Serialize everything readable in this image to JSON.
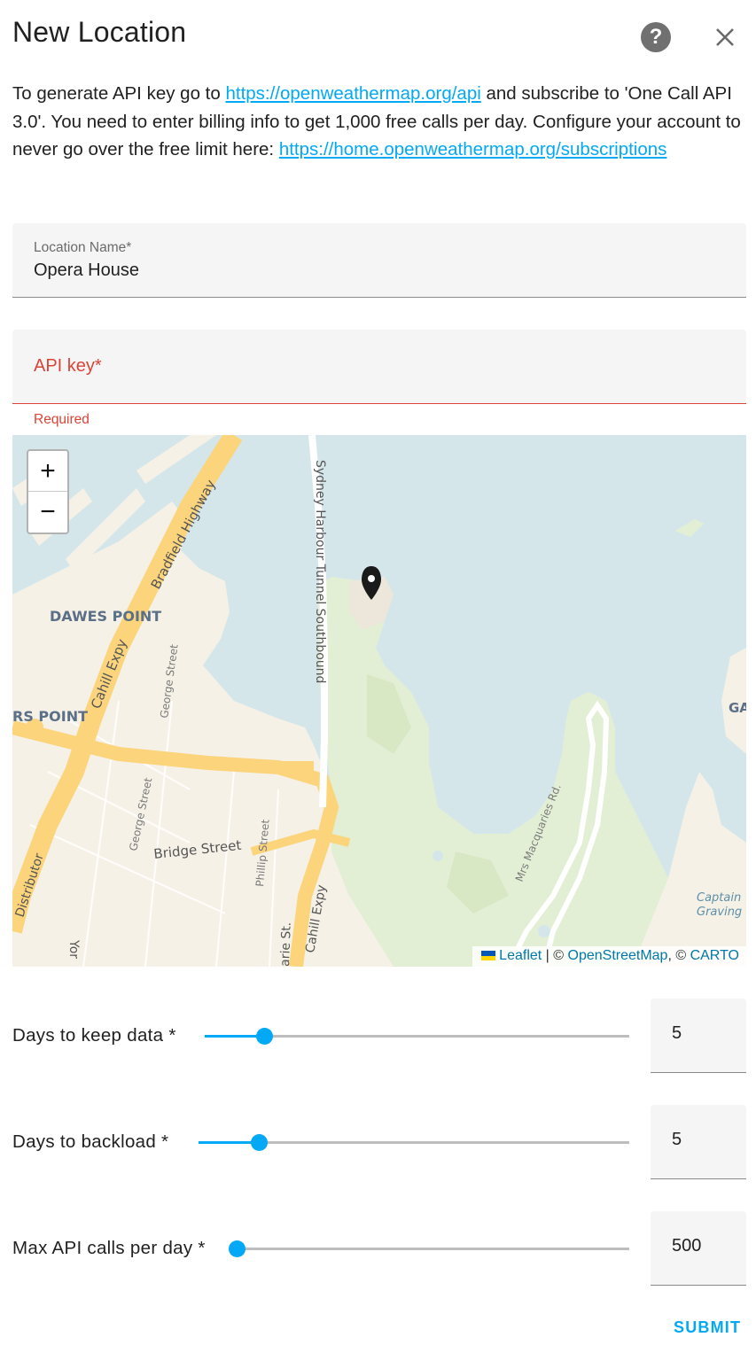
{
  "dialog": {
    "title": "New Location",
    "help_icon": "help-circle-icon",
    "close_icon": "close-icon"
  },
  "intro": {
    "text_1": "To generate API key go to ",
    "link_1": "https://openweathermap.org/api",
    "text_2": " and subscribe to 'One Call API 3.0'. You need to enter billing info to get 1,000 free calls per day. Configure your account to never go over the free limit here: ",
    "link_2": "https://home.openweathermap.org/subscriptions"
  },
  "location_name": {
    "label": "Location Name*",
    "value": "Opera House"
  },
  "api_key": {
    "label": "API key*",
    "value": "",
    "helper": "Required"
  },
  "map": {
    "zoom_in": "+",
    "zoom_out": "−",
    "labels": {
      "dawes_point": "DAWES POINT",
      "millers_point": "RS POINT",
      "bradfield": "Bradfield Highway",
      "cahill_expy_1": "Cahill Expy",
      "cahill_expy_2": "Cahill Expy",
      "tunnel": "Sydney Harbour Tunnel Southbound",
      "george_st_1": "George Street",
      "george_st_2": "George Street",
      "george_st_3": "George Street",
      "bridge_st": "Bridge Street",
      "phillip_st": "Phillip Street",
      "macquarie_st": "arie St.",
      "macquaries_rd": "Mrs Macquaries Rd.",
      "distributor": "Distributor",
      "york": "Yor",
      "captain_1": "Captain",
      "captain_2": "Graving",
      "ga": "GA"
    },
    "attribution": {
      "leaflet": "Leaflet",
      "sep_1": " | © ",
      "osm": "OpenStreetMap",
      "sep_2": ", © ",
      "carto": "CARTO"
    },
    "colors": {
      "water": "#d5e6ea",
      "land": "#f5f1e6",
      "park": "#e3efd5",
      "highway": "#fbd47c"
    }
  },
  "sliders": [
    {
      "label": "Days to keep data *",
      "value": "5",
      "fraction": 0.14
    },
    {
      "label": "Days to backload *",
      "value": "5",
      "fraction": 0.14
    },
    {
      "label": "Max API calls per day *",
      "value": "500",
      "fraction": 0.0
    }
  ],
  "actions": {
    "submit": "SUBMIT"
  },
  "theme": {
    "accent": "#03a9f4",
    "error": "#db4437"
  }
}
